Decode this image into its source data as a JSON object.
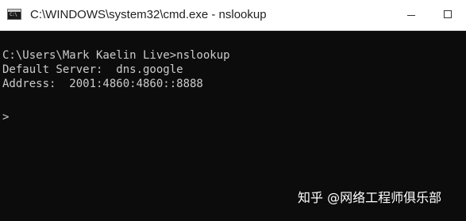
{
  "titlebar": {
    "app_icon": "cmd-icon",
    "app_icon_glyph": "C:\\",
    "title": "C:\\WINDOWS\\system32\\cmd.exe - nslookup",
    "buttons": [
      "minimize-icon",
      "maximize-icon"
    ]
  },
  "console": {
    "lines": [
      "C:\\Users\\Mark Kaelin Live>nslookup",
      "Default Server:  dns.google",
      "Address:  2001:4860:4860::8888",
      ">"
    ],
    "colors": {
      "background": "#0c0c0c",
      "text": "#cccccc"
    }
  },
  "watermark": {
    "text": "知乎 @网络工程师俱乐部"
  }
}
